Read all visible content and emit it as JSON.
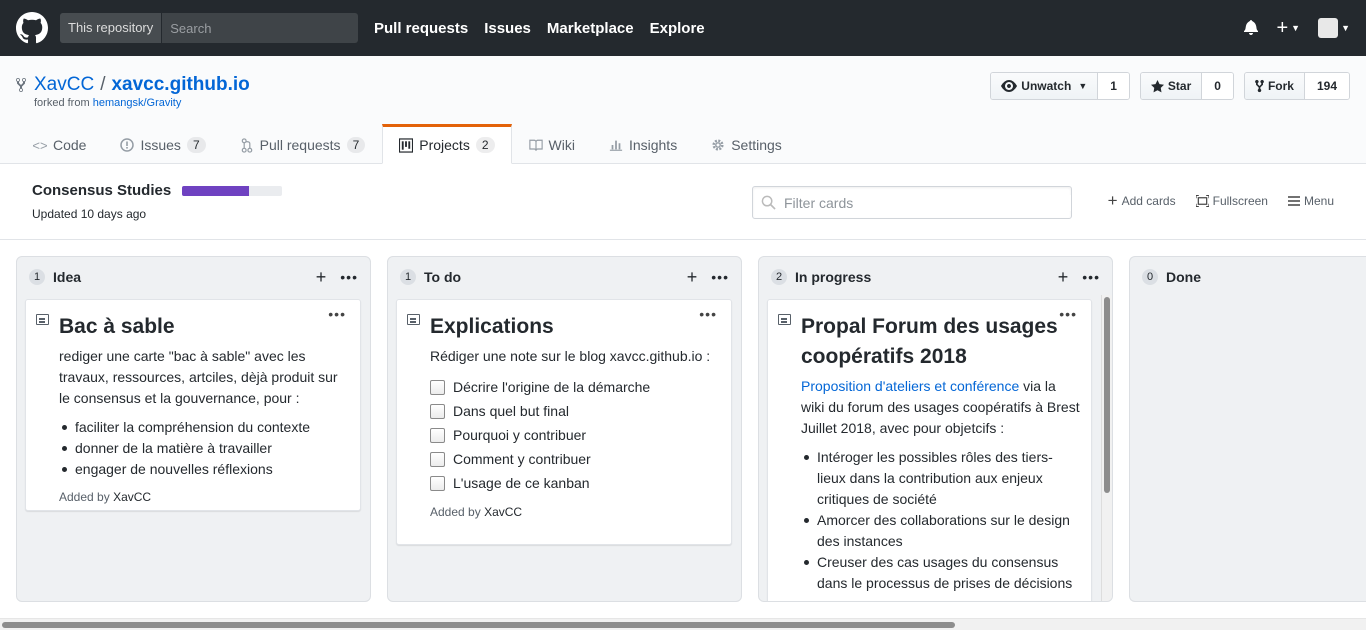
{
  "topbar": {
    "scope_label": "This repository",
    "search_placeholder": "Search",
    "nav": [
      "Pull requests",
      "Issues",
      "Marketplace",
      "Explore"
    ]
  },
  "repo": {
    "owner": "XavCC",
    "separator": "/",
    "name": "xavcc.github.io",
    "forked_prefix": "forked from",
    "forked_source": "hemangsk/Gravity",
    "watch_label": "Unwatch",
    "watch_count": "1",
    "star_label": "Star",
    "star_count": "0",
    "fork_label": "Fork",
    "fork_count": "194"
  },
  "tabs": [
    {
      "label": "Code",
      "count": ""
    },
    {
      "label": "Issues",
      "count": "7"
    },
    {
      "label": "Pull requests",
      "count": "7"
    },
    {
      "label": "Projects",
      "count": "2"
    },
    {
      "label": "Wiki",
      "count": ""
    },
    {
      "label": "Insights",
      "count": ""
    },
    {
      "label": "Settings",
      "count": ""
    }
  ],
  "project": {
    "name": "Consensus Studies",
    "progress": 0.67,
    "updated": "Updated 10 days ago",
    "filter_placeholder": "Filter cards",
    "add_cards": "Add cards",
    "fullscreen": "Fullscreen",
    "menu": "Menu"
  },
  "columns": [
    {
      "count": "1",
      "title": "Idea",
      "card": {
        "title": "Bac à sable",
        "body": "rediger une carte \"bac à sable\" avec les travaux, ressources, artciles, dèjà produit sur le consensus et la gouvernance, pour :",
        "bullets": [
          "faciliter la compréhension du contexte",
          "donner de la matière à travailler",
          "engager de nouvelles réflexions"
        ],
        "added_prefix": "Added by",
        "added_by": "XavCC"
      }
    },
    {
      "count": "1",
      "title": "To do",
      "card": {
        "title": "Explications",
        "body": "Rédiger une note sur le blog xavcc.github.io :",
        "tasks": [
          "Décrire l'origine de la démarche",
          "Dans quel but final",
          "Pourquoi y contribuer",
          "Comment y contribuer",
          "L'usage de ce kanban"
        ],
        "added_prefix": "Added by",
        "added_by": "XavCC"
      }
    },
    {
      "count": "2",
      "title": "In progress",
      "card": {
        "title": "Propal Forum des usages coopératifs 2018",
        "link": "Proposition d'ateliers et conférence",
        "body": " via la wiki du forum des usages coopératifs à Brest Juillet 2018, avec pour objetcifs :",
        "bullets": [
          "Intéroger les possibles rôles des tiers-lieux dans la contribution aux enjeux critiques de société",
          "Amorcer des collaborations sur le design des instances",
          "Creuser des cas usages du consensus dans le processus de prises de décisions"
        ]
      }
    },
    {
      "count": "0",
      "title": "Done"
    }
  ],
  "colors": {
    "topbar": "#24292e",
    "link": "#0366d6",
    "progress": "#6f42c1",
    "tab_accent": "#e36209"
  }
}
